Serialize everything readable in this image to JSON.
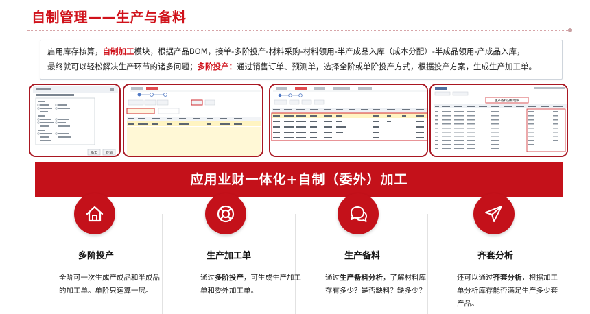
{
  "header": {
    "title": "自制管理——生产与备料"
  },
  "intro": {
    "line1_a": "启用库存核算，",
    "line1_hl": "自制加工",
    "line1_b": "模块，根据产品BOM，接单-多阶投产-材料采购-材料领用-半产成品入库（成本分配）-半成品领用-产成品入库，",
    "line2_a": "最终就可以轻松解决生产环节的诸多问题；",
    "line2_hl": "多阶投产：",
    "line2_b": "通过销售订单、预测单，选择全阶或单阶投产方式，根据投产方案，生成生产加工单。"
  },
  "banner": {
    "text": "应用业财一体化+自制（委外）加工"
  },
  "features": [
    {
      "title": "多阶投产",
      "icon": "house-icon",
      "text_a": "全阶可一次生成产成品和半成品的加工单。单阶只运算一层。",
      "text_b": "",
      "text_c": ""
    },
    {
      "title": "生产加工单",
      "icon": "lifebuoy-icon",
      "text_a": "通过",
      "text_b": "多阶投产",
      "text_c": "，可生成生产加工单和委外加工单。"
    },
    {
      "title": "生产备料",
      "icon": "chat-bubbles-icon",
      "text_a": "通过",
      "text_b": "生产备料分析",
      "text_c": "，了解材料库存有多少？是否缺料？缺多少？"
    },
    {
      "title": "齐套分析",
      "icon": "paper-plane-icon",
      "text_a": "还可以通过",
      "text_b": "齐套分析",
      "text_c": "，根据加工单分析库存能否满足生产多少套产品。"
    }
  ],
  "screenshots": {
    "s4_caption": "生产备料分析明细",
    "s1_button_ok": "确定",
    "s1_button_cancel": "取消"
  },
  "colors": {
    "accent": "#c4111a",
    "title": "#d0121b",
    "frame": "#a91722"
  }
}
